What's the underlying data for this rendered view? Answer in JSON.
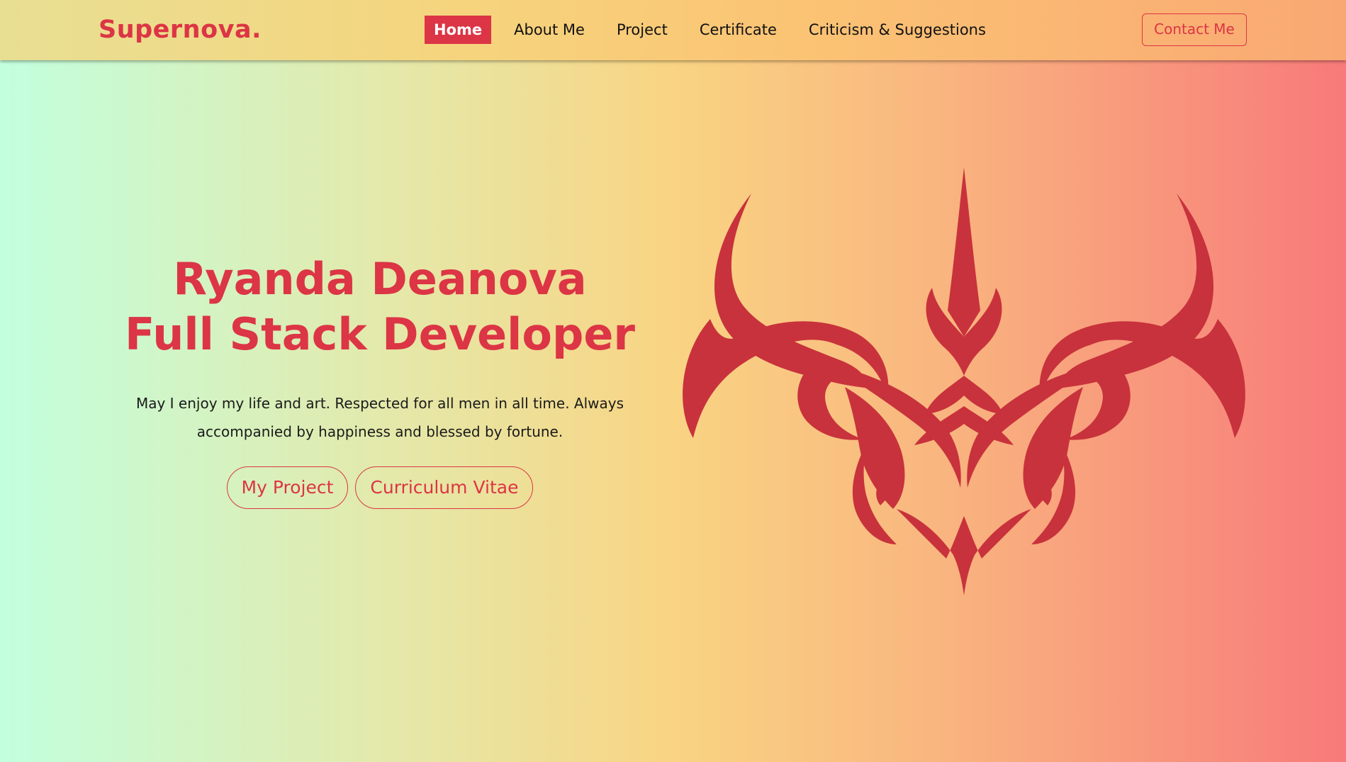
{
  "brand": {
    "name": "Supernova."
  },
  "nav": {
    "items": [
      {
        "label": "Home",
        "active": true
      },
      {
        "label": "About Me",
        "active": false
      },
      {
        "label": "Project",
        "active": false
      },
      {
        "label": "Certificate",
        "active": false
      },
      {
        "label": "Criticism & Suggestions",
        "active": false
      }
    ],
    "contact_label": "Contact Me"
  },
  "hero": {
    "title_line1": "Ryanda Deanova",
    "title_line2": "Full Stack Developer",
    "description": "May I enjoy my life and art. Respected for all men in all time. Always accompanied by happiness and blessed by fortune.",
    "buttons": {
      "project_label": "My Project",
      "cv_label": "Curriculum Vitae"
    },
    "art_icon": "tribal-emblem-icon"
  },
  "colors": {
    "accent": "#dc3545",
    "art": "#c8323c",
    "gradient_start": "#c2ffde",
    "gradient_mid": "#f9d483",
    "gradient_end": "#f87a7a"
  }
}
